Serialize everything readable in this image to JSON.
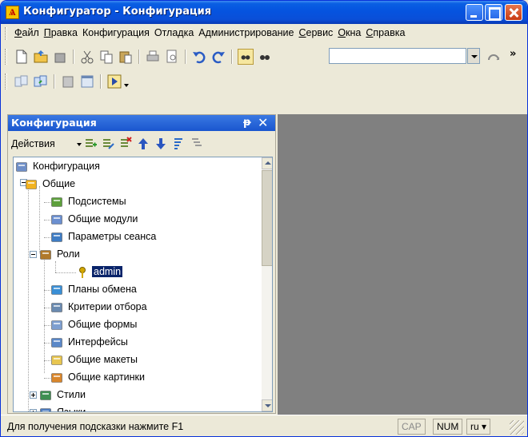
{
  "window": {
    "title": "Конфигуратор - Конфигурация"
  },
  "menu": {
    "items": [
      {
        "pre": "",
        "u": "Ф",
        "post": "айл"
      },
      {
        "pre": "",
        "u": "П",
        "post": "равка"
      },
      {
        "pre": "Конфигурация",
        "u": "",
        "post": ""
      },
      {
        "pre": "Отладка",
        "u": "",
        "post": ""
      },
      {
        "pre": "Администрирование",
        "u": "",
        "post": ""
      },
      {
        "pre": "",
        "u": "С",
        "post": "ервис"
      },
      {
        "pre": "",
        "u": "О",
        "post": "кна"
      },
      {
        "pre": "",
        "u": "С",
        "post": "правка"
      }
    ]
  },
  "toolbar": {
    "search_value": "",
    "overflow": "»"
  },
  "panel": {
    "title": "Конфигурация",
    "pin": "ᵽ",
    "close": "✕",
    "actions_label": "Действия"
  },
  "tree": {
    "nodes": [
      {
        "label": "Конфигурация",
        "icon": "configuration-icon",
        "color": "#6f8fc8"
      },
      {
        "label": "Общие",
        "icon": "common-folder-icon",
        "color": "#f2b320"
      },
      {
        "label": "Подсистемы",
        "icon": "subsystems-icon",
        "color": "#5da03c"
      },
      {
        "label": "Общие модули",
        "icon": "common-modules-icon",
        "color": "#6b8fd0"
      },
      {
        "label": "Параметры сеанса",
        "icon": "session-params-icon",
        "color": "#3e7cc4"
      },
      {
        "label": "Роли",
        "icon": "roles-icon",
        "color": "#b0792a"
      },
      {
        "label": "admin",
        "icon": "key-icon",
        "color": "#d4a800"
      },
      {
        "label": "Планы обмена",
        "icon": "exchange-plans-icon",
        "color": "#3a8fd6"
      },
      {
        "label": "Критерии отбора",
        "icon": "filter-criteria-icon",
        "color": "#6a8ab0"
      },
      {
        "label": "Общие формы",
        "icon": "common-forms-icon",
        "color": "#7e9fd0"
      },
      {
        "label": "Интерфейсы",
        "icon": "interfaces-icon",
        "color": "#5b88c8"
      },
      {
        "label": "Общие макеты",
        "icon": "common-templates-icon",
        "color": "#e8c650"
      },
      {
        "label": "Общие картинки",
        "icon": "common-pictures-icon",
        "color": "#d9862b"
      },
      {
        "label": "Стили",
        "icon": "styles-icon",
        "color": "#3f8f52"
      },
      {
        "label": "Языки",
        "icon": "languages-icon",
        "color": "#4d7cc0"
      }
    ]
  },
  "status": {
    "hint": "Для получения подсказки нажмите F1",
    "cap": "CAP",
    "num": "NUM",
    "lang": "ru"
  }
}
